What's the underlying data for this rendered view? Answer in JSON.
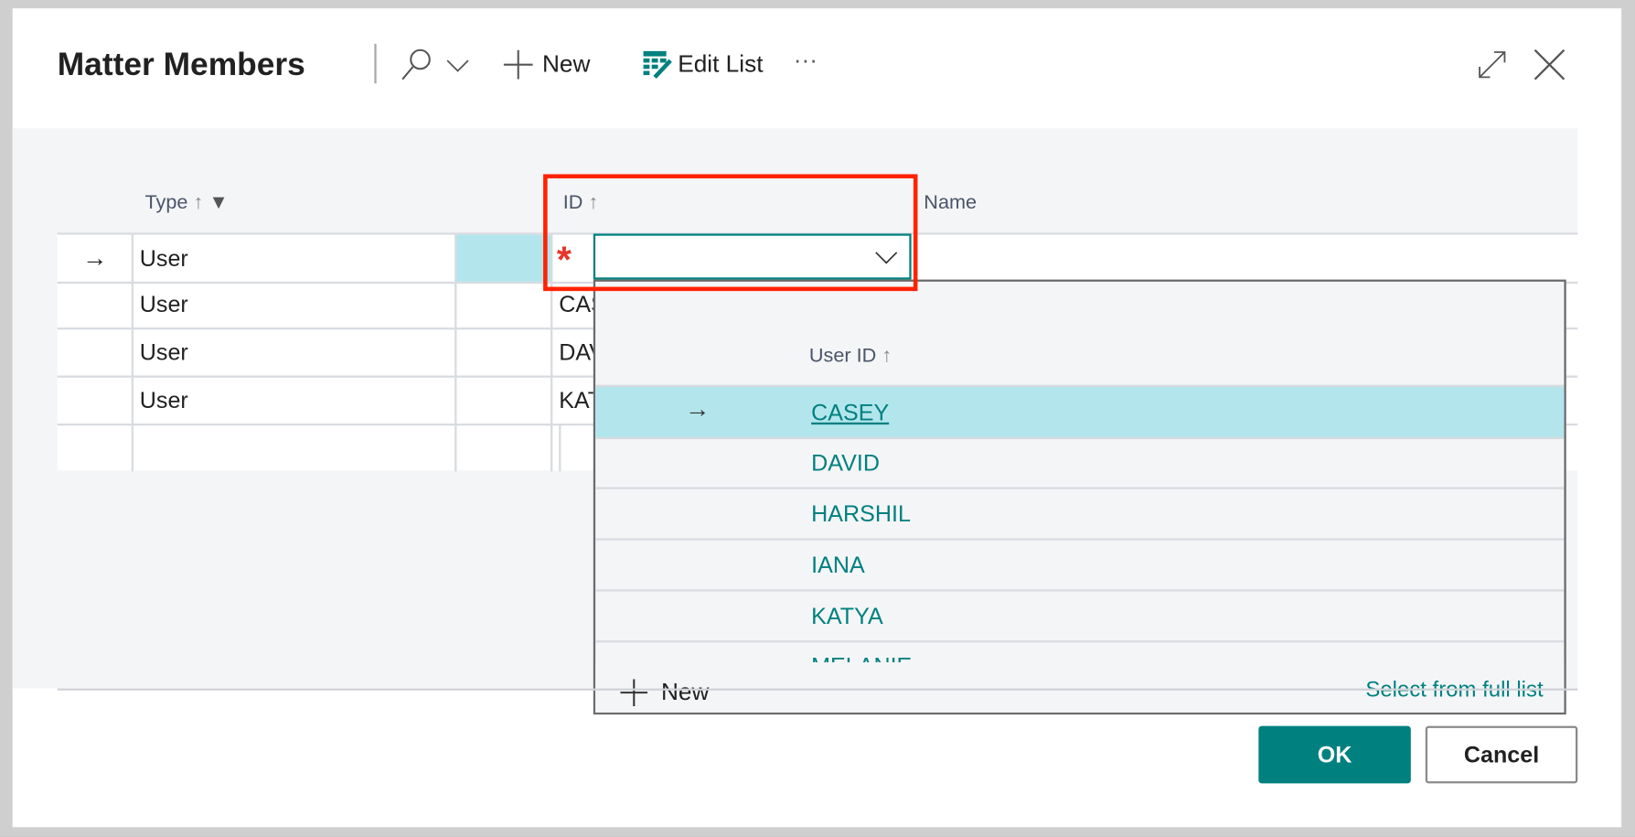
{
  "dialog": {
    "title": "Matter Members"
  },
  "toolbar": {
    "new_label": "New",
    "edit_list_label": "Edit List",
    "more_label": "···"
  },
  "table": {
    "headers": {
      "type": "Type",
      "id": "ID",
      "name": "Name"
    },
    "rows": [
      {
        "type": "User",
        "id": ""
      },
      {
        "type": "User",
        "id": "CAS"
      },
      {
        "type": "User",
        "id": "DAV"
      },
      {
        "type": "User",
        "id": "KAT"
      }
    ]
  },
  "dropdown": {
    "header": "User ID",
    "items": [
      "CASEY",
      "DAVID",
      "HARSHIL",
      "IANA",
      "KATYA",
      "MELANIE"
    ],
    "new_label": "New",
    "full_list_label": "Select from full list"
  },
  "buttons": {
    "ok": "OK",
    "cancel": "Cancel"
  },
  "colors": {
    "accent": "#00807f",
    "highlight": "#b2e6ec",
    "required": "#e8362a",
    "annotation": "#ff2200"
  }
}
